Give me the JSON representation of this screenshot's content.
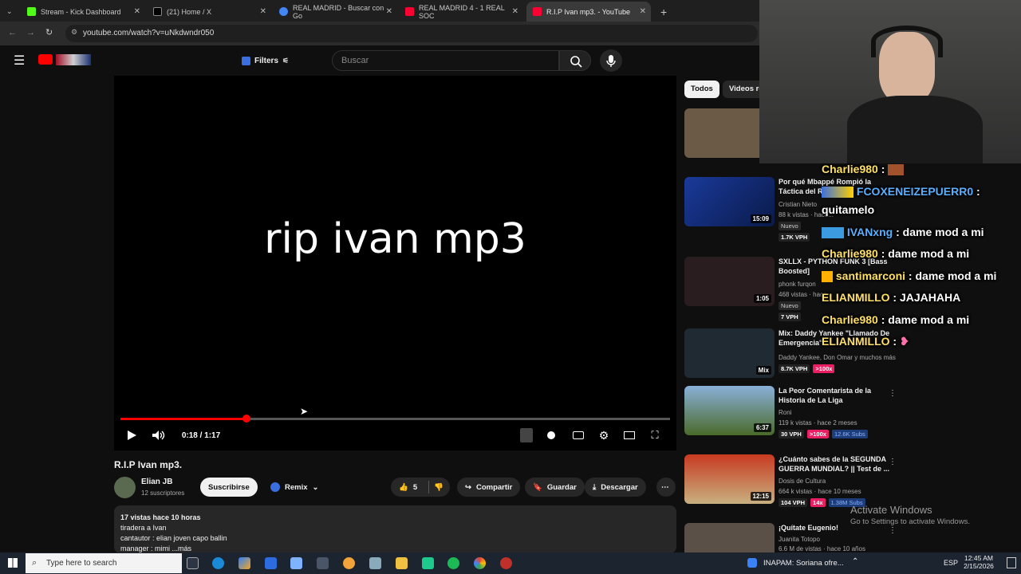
{
  "browser": {
    "tabs": [
      {
        "label": "Stream - Kick Dashboard",
        "color": "#53fc18"
      },
      {
        "label": "(21) Home / X",
        "color": "#ffffff"
      },
      {
        "label": "REAL MADRID - Buscar con Go",
        "color": "#4285f4"
      },
      {
        "label": "REAL MADRID 4 - 1 REAL SOC",
        "color": "#ff0033"
      },
      {
        "label": "R.I.P Ivan mp3. - YouTube",
        "color": "#ff0033"
      }
    ],
    "url": "youtube.com/watch?v=uNkdwndr050"
  },
  "yt_header": {
    "filters_label": "Filters",
    "search_placeholder": "Buscar"
  },
  "player": {
    "overlay_text": "rip ivan mp3",
    "time": "0:18 / 1:17",
    "progress": 0.23
  },
  "video": {
    "title": "R.I.P Ivan mp3.",
    "channel": "Elian JB",
    "subscribers": "12 suscriptores",
    "subscribe_label": "Suscribirse",
    "remix_label": "Remix",
    "likes": "5",
    "share_label": "Compartir",
    "save_label": "Guardar",
    "download_label": "Descargar",
    "desc_meta": "17 vistas  hace 10 horas",
    "desc_lines": [
      "tiradera a Ivan",
      "cantautor : elian joven capo ballin",
      "manager : mimi ...más"
    ]
  },
  "sidebar": {
    "chips": [
      "Todos",
      "Videos re"
    ],
    "recs": [
      {
        "title": "",
        "channel": "",
        "duration": "",
        "badge": "",
        "vph": "",
        "mult": "",
        "subs": "",
        "thumb": "#6b5a45"
      },
      {
        "title": "Por qué Mbappé Rompió la Táctica del R...",
        "channel": "Cristian Nieto",
        "meta": "88 k vistas · hace...",
        "duration": "15:09",
        "badge": "Nuevo",
        "vph": "1.7K VPH",
        "mult": "",
        "subs": "",
        "thumb": "#203a7a"
      },
      {
        "title": "SXLLX - PYTHON FUNK 3 [Bass Boosted]",
        "channel": "phonk furqon",
        "meta": "468 vistas · hace...",
        "duration": "1:05",
        "badge": "Nuevo",
        "vph": "7 VPH",
        "mult": "",
        "subs": "",
        "thumb": "#2a1d20"
      },
      {
        "title": "Mix: Daddy Yankee \"Llamado De Emergencia\"",
        "channel": "Daddy Yankee, Don Omar y muchos más",
        "meta": "",
        "duration": "Mix",
        "badge": "",
        "vph": "8.7K VPH",
        "mult": ">100x",
        "subs": "",
        "thumb": "#1f2a33"
      },
      {
        "title": "La Peor Comentarista de la Historia de La Liga",
        "channel": "Roni",
        "meta": "119 k vistas · hace 2 meses",
        "duration": "6:37",
        "badge": "",
        "vph": "30 VPH",
        "mult": ">100x",
        "subs": "12.6K Subs",
        "thumb": "#4a6a2a"
      },
      {
        "title": "¿Cuánto sabes de la SEGUNDA GUERRA MUNDIAL? || Test de ...",
        "channel": "Dosis de Cultura",
        "meta": "664 k vistas · hace 10 meses",
        "duration": "12:15",
        "badge": "",
        "vph": "104 VPH",
        "mult": "14x",
        "subs": "1.38M Subs",
        "thumb": "#b03020"
      },
      {
        "title": "¡Quítate Eugenio!",
        "channel": "Juanita Totopo",
        "meta": "6.6 M de vistas · hace 10 años",
        "duration": "",
        "badge": "",
        "vph": "",
        "mult": "",
        "subs": "",
        "thumb": "#5a5048"
      }
    ]
  },
  "chat": [
    {
      "user": "Charlie980",
      "text": "",
      "color": "#ffe066"
    },
    {
      "user": "FCOXENEIZEPUERR0",
      "text": "",
      "color": "#5ab0ff"
    },
    {
      "user": "",
      "text": "quitamelo",
      "color": "#ffffff"
    },
    {
      "user": "IVANxng",
      "text": "dame mod a mi",
      "color": "#5ab0ff"
    },
    {
      "user": "Charlie980",
      "text": "dame mod a mi",
      "color": "#ffe066"
    },
    {
      "user": "santimarconi",
      "text": "dame mod a mi",
      "color": "#ffe066"
    },
    {
      "user": "ELIANMILLO",
      "text": "JAJAHAHA",
      "color": "#ffe066"
    },
    {
      "user": "Charlie980",
      "text": "dame mod a mi",
      "color": "#ffe066"
    },
    {
      "user": "ELIANMILLO",
      "text": "",
      "color": "#ffe066"
    }
  ],
  "windows_mark": {
    "line1": "Activate Windows",
    "line2": "Go to Settings to activate Windows."
  },
  "taskbar": {
    "search_placeholder": "Type here to search",
    "notification": "INAPAM: Soriana ofre...",
    "lang": "ESP",
    "time": "12:45 AM",
    "date": "2/15/2026"
  }
}
